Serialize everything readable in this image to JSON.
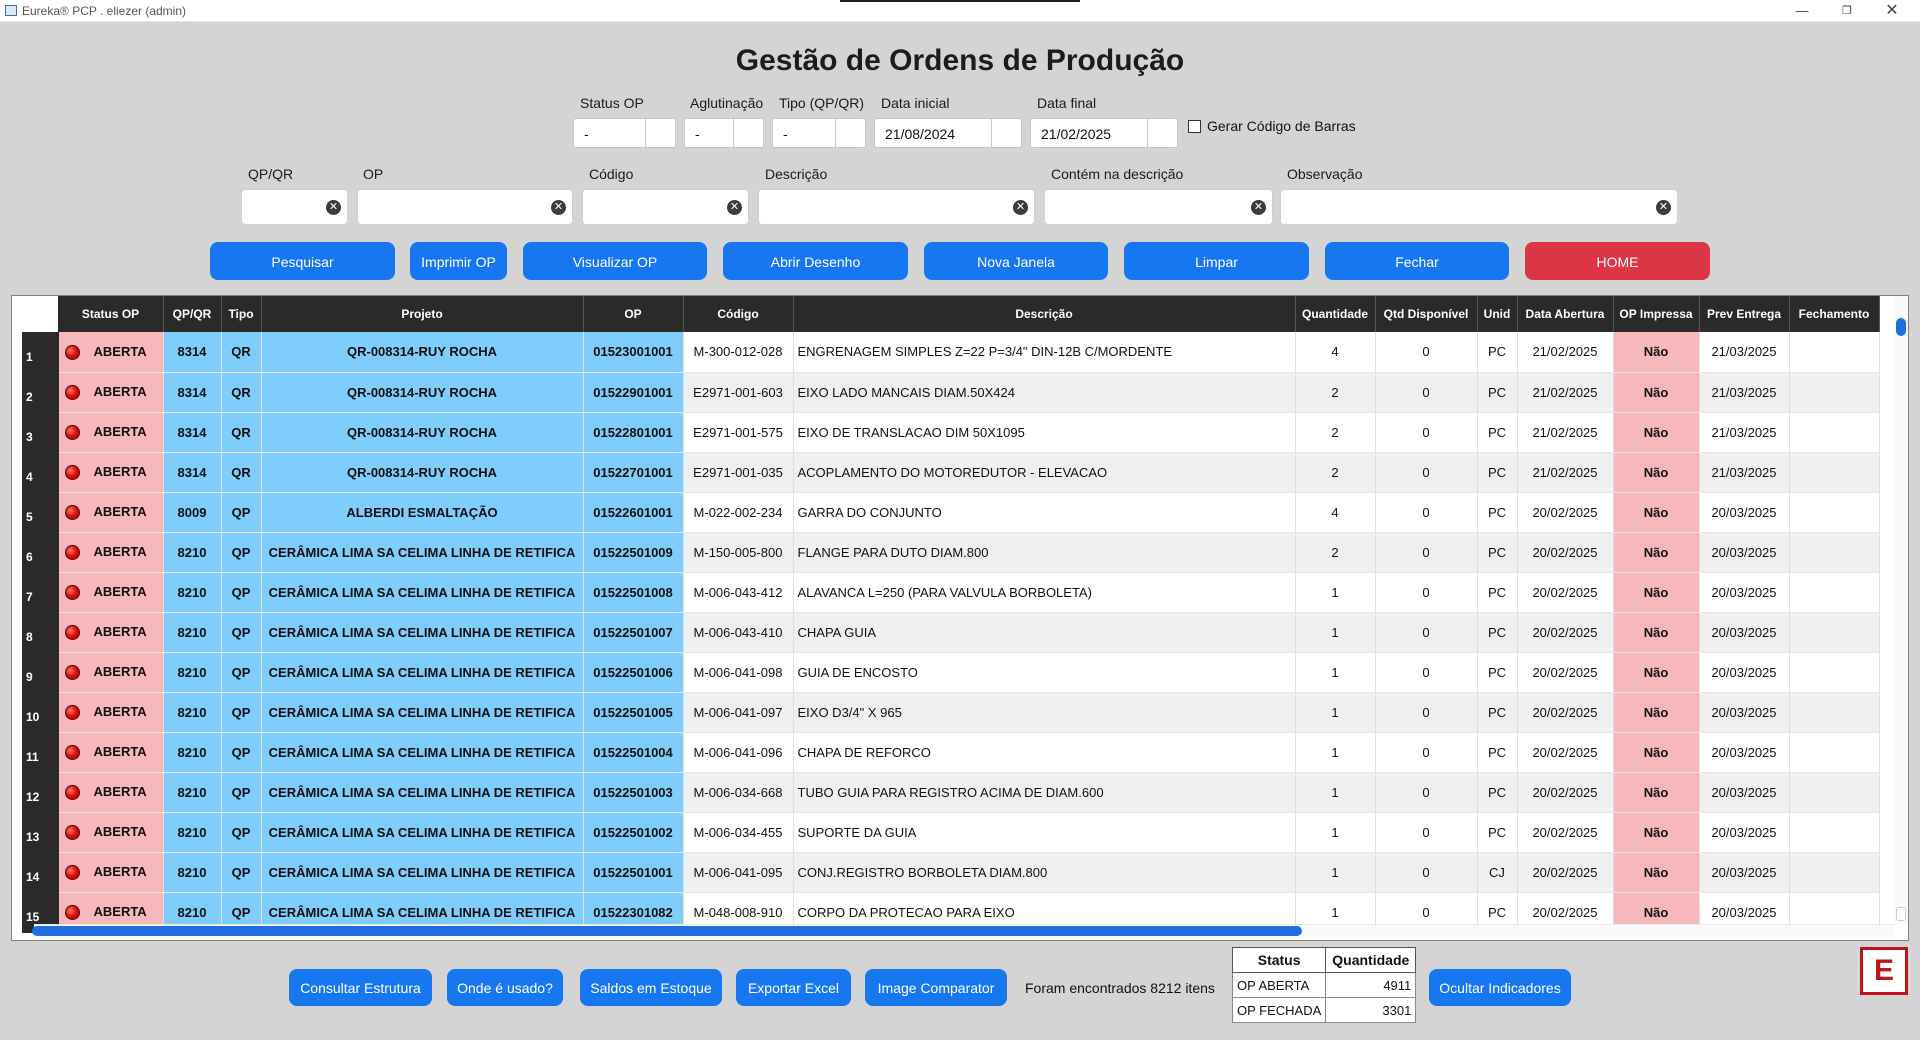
{
  "window": {
    "title": "Eureka® PCP . eliezer (admin)",
    "min": "—",
    "max": "❐",
    "close": "✕"
  },
  "page_title": "Gestão de Ordens de Produção",
  "filters": {
    "status_op": {
      "label": "Status OP",
      "value": "-"
    },
    "aglutinacao": {
      "label": "Aglutinação",
      "value": "-"
    },
    "tipo": {
      "label": "Tipo (QP/QR)",
      "value": "-"
    },
    "data_inicial": {
      "label": "Data inicial",
      "value": "21/08/2024"
    },
    "data_final": {
      "label": "Data final",
      "value": "21/02/2025"
    },
    "barcode": {
      "label": "Gerar Código de Barras",
      "checked": false
    }
  },
  "search": {
    "qpqr": {
      "label": "QP/QR",
      "value": ""
    },
    "op": {
      "label": "OP",
      "value": ""
    },
    "codigo": {
      "label": "Código",
      "value": ""
    },
    "descricao": {
      "label": "Descrição",
      "value": ""
    },
    "contem": {
      "label": "Contém na descrição",
      "value": ""
    },
    "observacao": {
      "label": "Observação",
      "value": ""
    }
  },
  "actions": {
    "pesquisar": "Pesquisar",
    "imprimir": "Imprimir OP",
    "visualizar": "Visualizar OP",
    "desenho": "Abrir Desenho",
    "nova_janela": "Nova Janela",
    "limpar": "Limpar",
    "fechar": "Fechar",
    "home": "HOME",
    "home_color": "#dc3545",
    "accent_color": "#1777f0"
  },
  "table": {
    "columns": [
      "Status OP",
      "QP/QR",
      "Tipo",
      "Projeto",
      "OP",
      "Código",
      "Descrição",
      "Quantidade",
      "Qtd Disponível",
      "Unid",
      "Data Abertura",
      "OP Impressa",
      "Prev Entrega",
      "Fechamento"
    ],
    "rows": [
      {
        "n": "1",
        "status": "ABERTA",
        "qpqr": "8314",
        "tipo": "QR",
        "projeto": "QR-008314-RUY ROCHA",
        "op": "01523001001",
        "codigo": "M-300-012-028",
        "descricao": "ENGRENAGEM SIMPLES Z=22 P=3/4\" DIN-12B C/MORDENTE",
        "qtd": "4",
        "disp": "0",
        "unid": "PC",
        "abertura": "21/02/2025",
        "impressa": "Não",
        "prev": "21/03/2025",
        "fechamento": ""
      },
      {
        "n": "2",
        "status": "ABERTA",
        "qpqr": "8314",
        "tipo": "QR",
        "projeto": "QR-008314-RUY ROCHA",
        "op": "01522901001",
        "codigo": "E2971-001-603",
        "descricao": "EIXO LADO MANCAIS DIAM.50X424",
        "qtd": "2",
        "disp": "0",
        "unid": "PC",
        "abertura": "21/02/2025",
        "impressa": "Não",
        "prev": "21/03/2025",
        "fechamento": ""
      },
      {
        "n": "3",
        "status": "ABERTA",
        "qpqr": "8314",
        "tipo": "QR",
        "projeto": "QR-008314-RUY ROCHA",
        "op": "01522801001",
        "codigo": "E2971-001-575",
        "descricao": "EIXO DE TRANSLACAO DIM 50X1095",
        "qtd": "2",
        "disp": "0",
        "unid": "PC",
        "abertura": "21/02/2025",
        "impressa": "Não",
        "prev": "21/03/2025",
        "fechamento": ""
      },
      {
        "n": "4",
        "status": "ABERTA",
        "qpqr": "8314",
        "tipo": "QR",
        "projeto": "QR-008314-RUY ROCHA",
        "op": "01522701001",
        "codigo": "E2971-001-035",
        "descricao": "ACOPLAMENTO DO MOTOREDUTOR - ELEVACAO",
        "qtd": "2",
        "disp": "0",
        "unid": "PC",
        "abertura": "21/02/2025",
        "impressa": "Não",
        "prev": "21/03/2025",
        "fechamento": ""
      },
      {
        "n": "5",
        "status": "ABERTA",
        "qpqr": "8009",
        "tipo": "QP",
        "projeto": "ALBERDI  ESMALTAÇÃO",
        "op": "01522601001",
        "codigo": "M-022-002-234",
        "descricao": "GARRA DO CONJUNTO",
        "qtd": "4",
        "disp": "0",
        "unid": "PC",
        "abertura": "20/02/2025",
        "impressa": "Não",
        "prev": "20/03/2025",
        "fechamento": ""
      },
      {
        "n": "6",
        "status": "ABERTA",
        "qpqr": "8210",
        "tipo": "QP",
        "projeto": "CERÂMICA LIMA SA  CELIMA  LINHA DE RETIFICA",
        "op": "01522501009",
        "codigo": "M-150-005-800",
        "descricao": "FLANGE PARA DUTO DIAM.800",
        "qtd": "2",
        "disp": "0",
        "unid": "PC",
        "abertura": "20/02/2025",
        "impressa": "Não",
        "prev": "20/03/2025",
        "fechamento": ""
      },
      {
        "n": "7",
        "status": "ABERTA",
        "qpqr": "8210",
        "tipo": "QP",
        "projeto": "CERÂMICA LIMA SA  CELIMA  LINHA DE RETIFICA",
        "op": "01522501008",
        "codigo": "M-006-043-412",
        "descricao": "ALAVANCA L=250 (PARA VALVULA BORBOLETA)",
        "qtd": "1",
        "disp": "0",
        "unid": "PC",
        "abertura": "20/02/2025",
        "impressa": "Não",
        "prev": "20/03/2025",
        "fechamento": ""
      },
      {
        "n": "8",
        "status": "ABERTA",
        "qpqr": "8210",
        "tipo": "QP",
        "projeto": "CERÂMICA LIMA SA  CELIMA  LINHA DE RETIFICA",
        "op": "01522501007",
        "codigo": "M-006-043-410",
        "descricao": "CHAPA GUIA",
        "qtd": "1",
        "disp": "0",
        "unid": "PC",
        "abertura": "20/02/2025",
        "impressa": "Não",
        "prev": "20/03/2025",
        "fechamento": ""
      },
      {
        "n": "9",
        "status": "ABERTA",
        "qpqr": "8210",
        "tipo": "QP",
        "projeto": "CERÂMICA LIMA SA  CELIMA  LINHA DE RETIFICA",
        "op": "01522501006",
        "codigo": "M-006-041-098",
        "descricao": "GUIA DE ENCOSTO",
        "qtd": "1",
        "disp": "0",
        "unid": "PC",
        "abertura": "20/02/2025",
        "impressa": "Não",
        "prev": "20/03/2025",
        "fechamento": ""
      },
      {
        "n": "10",
        "status": "ABERTA",
        "qpqr": "8210",
        "tipo": "QP",
        "projeto": "CERÂMICA LIMA SA  CELIMA  LINHA DE RETIFICA",
        "op": "01522501005",
        "codigo": "M-006-041-097",
        "descricao": "EIXO D3/4\" X 965",
        "qtd": "1",
        "disp": "0",
        "unid": "PC",
        "abertura": "20/02/2025",
        "impressa": "Não",
        "prev": "20/03/2025",
        "fechamento": ""
      },
      {
        "n": "11",
        "status": "ABERTA",
        "qpqr": "8210",
        "tipo": "QP",
        "projeto": "CERÂMICA LIMA SA  CELIMA  LINHA DE RETIFICA",
        "op": "01522501004",
        "codigo": "M-006-041-096",
        "descricao": "CHAPA DE REFORCO",
        "qtd": "1",
        "disp": "0",
        "unid": "PC",
        "abertura": "20/02/2025",
        "impressa": "Não",
        "prev": "20/03/2025",
        "fechamento": ""
      },
      {
        "n": "12",
        "status": "ABERTA",
        "qpqr": "8210",
        "tipo": "QP",
        "projeto": "CERÂMICA LIMA SA  CELIMA  LINHA DE RETIFICA",
        "op": "01522501003",
        "codigo": "M-006-034-668",
        "descricao": "TUBO GUIA PARA REGISTRO ACIMA DE DIAM.600",
        "qtd": "1",
        "disp": "0",
        "unid": "PC",
        "abertura": "20/02/2025",
        "impressa": "Não",
        "prev": "20/03/2025",
        "fechamento": ""
      },
      {
        "n": "13",
        "status": "ABERTA",
        "qpqr": "8210",
        "tipo": "QP",
        "projeto": "CERÂMICA LIMA SA  CELIMA  LINHA DE RETIFICA",
        "op": "01522501002",
        "codigo": "M-006-034-455",
        "descricao": "SUPORTE DA GUIA",
        "qtd": "1",
        "disp": "0",
        "unid": "PC",
        "abertura": "20/02/2025",
        "impressa": "Não",
        "prev": "20/03/2025",
        "fechamento": ""
      },
      {
        "n": "14",
        "status": "ABERTA",
        "qpqr": "8210",
        "tipo": "QP",
        "projeto": "CERÂMICA LIMA SA  CELIMA  LINHA DE RETIFICA",
        "op": "01522501001",
        "codigo": "M-006-041-095",
        "descricao": "CONJ.REGISTRO BORBOLETA DIAM.800",
        "qtd": "1",
        "disp": "0",
        "unid": "CJ",
        "abertura": "20/02/2025",
        "impressa": "Não",
        "prev": "20/03/2025",
        "fechamento": ""
      },
      {
        "n": "15",
        "status": "ABERTA",
        "qpqr": "8210",
        "tipo": "QP",
        "projeto": "CERÂMICA LIMA SA  CELIMA  LINHA DE RETIFICA",
        "op": "01522301082",
        "codigo": "M-048-008-910",
        "descricao": "CORPO DA PROTECAO PARA EIXO",
        "qtd": "1",
        "disp": "0",
        "unid": "PC",
        "abertura": "20/02/2025",
        "impressa": "Não",
        "prev": "20/03/2025",
        "fechamento": ""
      }
    ]
  },
  "footer": {
    "consultar": "Consultar Estrutura",
    "onde": "Onde é usado?",
    "saldos": "Saldos em Estoque",
    "exportar": "Exportar Excel",
    "comparator": "Image Comparator",
    "found": "Foram encontrados 8212 itens",
    "ocultar": "Ocultar Indicadores",
    "summary": {
      "col_status": "Status",
      "col_qtd": "Quantidade",
      "rows": [
        {
          "status": "OP ABERTA",
          "qtd": "4911"
        },
        {
          "status": "OP FECHADA",
          "qtd": "3301"
        }
      ]
    },
    "logo": "E"
  },
  "icons": {
    "clear": "clear-circle-icon",
    "status_dot": "red-status-icon",
    "logo": "eureka-logo-icon"
  }
}
